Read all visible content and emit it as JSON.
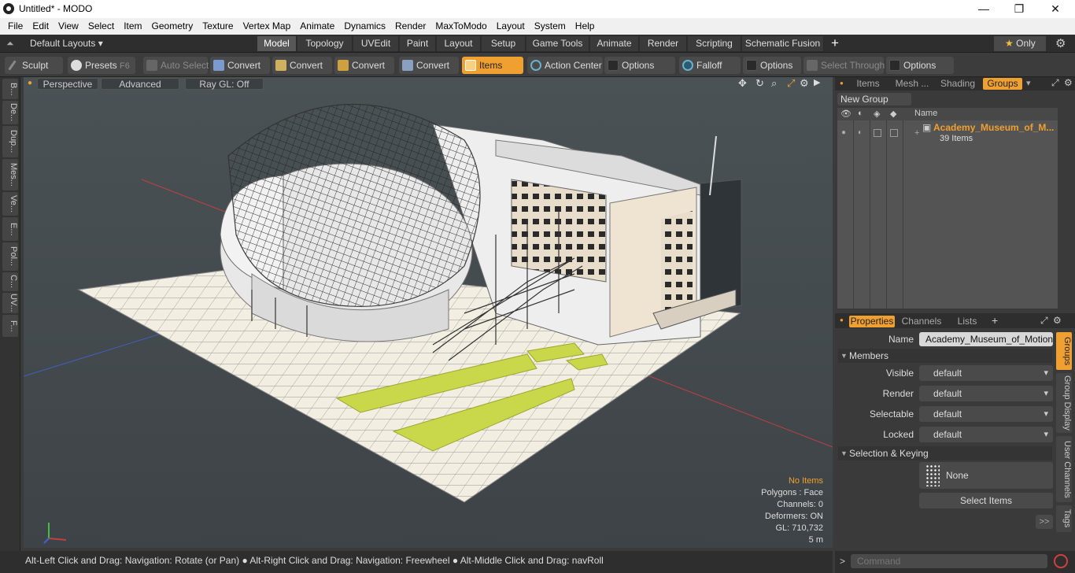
{
  "window": {
    "title": "Untitled* - MODO",
    "min": "—",
    "max": "❐",
    "close": "✕"
  },
  "menu": [
    "File",
    "Edit",
    "View",
    "Select",
    "Item",
    "Geometry",
    "Texture",
    "Vertex Map",
    "Animate",
    "Dynamics",
    "Render",
    "MaxToModo",
    "Layout",
    "System",
    "Help"
  ],
  "layoutbar": {
    "layouts_label": "Default Layouts",
    "tabs": [
      "Model",
      "Topology",
      "UVEdit",
      "Paint",
      "Layout",
      "Setup",
      "Game Tools",
      "Animate",
      "Render",
      "Scripting",
      "Schematic Fusion"
    ],
    "active_tab": "Model",
    "add": "+",
    "only_label": "Only"
  },
  "toolbar": {
    "sculpt": "Sculpt",
    "presets": "Presets",
    "presets_key": "F6",
    "auto_select": "Auto Select",
    "convert1": "Convert",
    "convert2": "Convert",
    "convert3": "Convert",
    "convert4": "Convert",
    "items": "Items",
    "action_center": "Action Center",
    "options1": "Options",
    "falloff": "Falloff",
    "options2": "Options",
    "select_through": "Select Through",
    "options3": "Options"
  },
  "left_tabs": [
    "B...",
    "De...",
    "Dup...",
    "Mes...",
    "Ve...",
    "E...",
    "Pol...",
    "C...",
    "UV...",
    "F..."
  ],
  "viewport": {
    "view": "Perspective",
    "advanced": "Advanced",
    "raygl": "Ray GL: Off",
    "info": {
      "no_items": "No Items",
      "polygons": "Polygons : Face",
      "channels": "Channels: 0",
      "deformers": "Deformers: ON",
      "gl": "GL: 710,732",
      "scale": "5 m"
    }
  },
  "status": "Alt-Left Click and Drag: Navigation: Rotate (or Pan) ● Alt-Right Click and Drag: Navigation: Freewheel ● Alt-Middle Click and Drag: navRoll",
  "groups_panel": {
    "tabs": [
      "Items",
      "Mesh ...",
      "Shading",
      "Groups"
    ],
    "active": "Groups",
    "new_group": "New Group",
    "col_name": "Name",
    "group_name": "Academy_Museum_of_M...",
    "group_count": "39 Items"
  },
  "properties_panel": {
    "tabs": [
      "Properties",
      "Channels",
      "Lists"
    ],
    "active": "Properties",
    "add": "+",
    "name_label": "Name",
    "name_value": "Academy_Museum_of_Motion_Pi",
    "members_section": "Members",
    "visible_label": "Visible",
    "visible_value": "default",
    "render_label": "Render",
    "render_value": "default",
    "selectable_label": "Selectable",
    "selectable_value": "default",
    "locked_label": "Locked",
    "locked_value": "default",
    "selection_section": "Selection & Keying",
    "none_label": "None",
    "select_items": "Select Items",
    "expand": ">>"
  },
  "right_vtabs": [
    "Groups",
    "Group Display",
    "User Channels",
    "Tags"
  ],
  "command": {
    "placeholder": "Command",
    "prompt": ">"
  },
  "colors": {
    "accent": "#f0a030",
    "grass": "#c8d84a",
    "x_axis": "#c04040",
    "y_axis": "#4060c0"
  }
}
